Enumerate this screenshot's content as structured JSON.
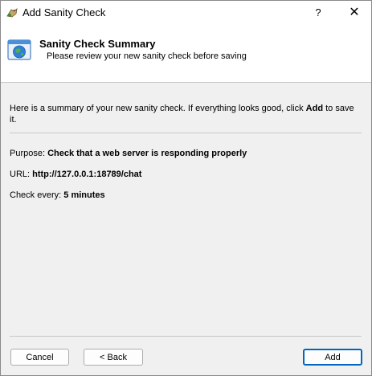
{
  "window": {
    "title": "Add Sanity Check",
    "help_glyph": "?",
    "close_glyph": "✕"
  },
  "header": {
    "title": "Sanity Check Summary",
    "subtitle": "Please review your new sanity check before saving",
    "icon": "globe-window-icon"
  },
  "intro": {
    "text_before": "Here is a summary of your new sanity check. If everything looks good, click ",
    "emphasis": "Add",
    "text_after": " to save it."
  },
  "summary": {
    "purpose_label": "Purpose:",
    "purpose_value": "Check that a web server is responding properly",
    "url_label": "URL:",
    "url_value": "http://127.0.0.1:18789/chat",
    "interval_label": "Check every:",
    "interval_value": "5 minutes"
  },
  "buttons": {
    "cancel": "Cancel",
    "back": "< Back",
    "add": "Add"
  }
}
